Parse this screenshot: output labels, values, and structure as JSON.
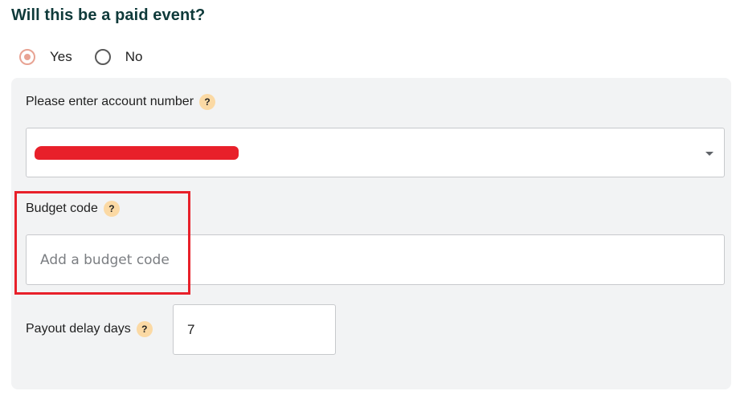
{
  "question": "Will this be a paid event?",
  "paid_options": [
    {
      "label": "Yes",
      "checked": true
    },
    {
      "label": "No",
      "checked": false
    }
  ],
  "account": {
    "label": "Please enter account number",
    "help": "?",
    "value_redacted": true
  },
  "budget": {
    "label": "Budget code",
    "help": "?",
    "placeholder": "Add a budget code",
    "value": ""
  },
  "payout": {
    "label": "Payout delay days",
    "help": "?",
    "value": "7"
  },
  "colors": {
    "heading": "#0f3a3a",
    "radio_selected": "#e8a393",
    "help_badge": "#fbd9a4",
    "panel": "#f2f3f4",
    "annotation": "#e8202a"
  },
  "icons": {
    "dropdown": "chevron-down-icon",
    "help": "question-mark-icon"
  }
}
